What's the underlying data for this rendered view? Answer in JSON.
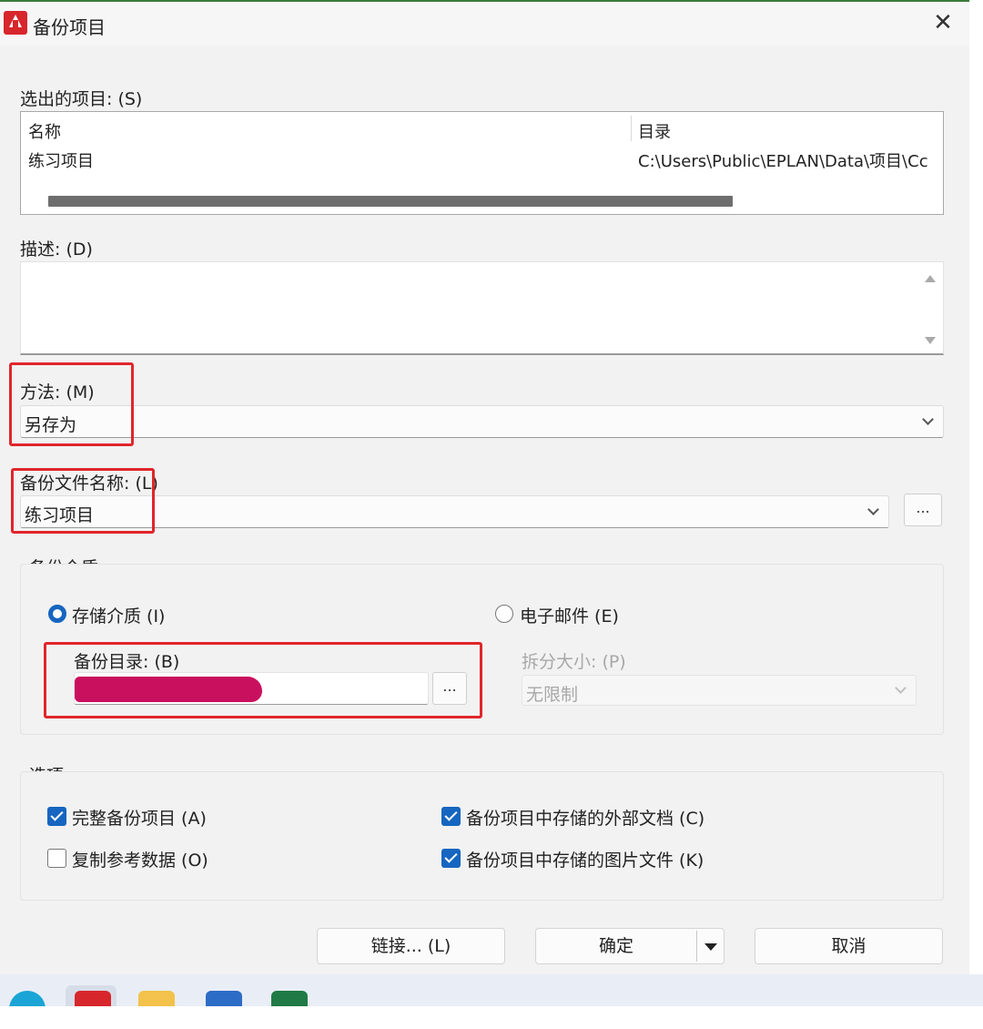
{
  "title": "备份项目",
  "selected_projects": {
    "label": "选出的项目: (S)",
    "columns": [
      "名称",
      "目录"
    ],
    "rows": [
      [
        "练习项目",
        "C:\\Users\\Public\\EPLAN\\Data\\项目\\Cc"
      ]
    ]
  },
  "description": {
    "label": "描述: (D)",
    "value": ""
  },
  "method": {
    "label": "方法: (M)",
    "value": "另存为"
  },
  "backup_filename": {
    "label": "备份文件名称: (L)",
    "value": "练习项目",
    "browse_label": "..."
  },
  "backup_media": {
    "label": "备份介质",
    "storage_label": "存储介质 (I)",
    "storage_selected": true,
    "email_label": "电子邮件 (E)",
    "email_selected": false,
    "backup_dir_label": "备份目录: (B)",
    "backup_dir_browse": "...",
    "split_size_label": "拆分大小: (P)",
    "split_size_value": "无限制"
  },
  "options": {
    "label": "选项",
    "full_backup_label": "完整备份项目 (A)",
    "full_backup_checked": true,
    "copy_ref_label": "复制参考数据 (O)",
    "copy_ref_checked": false,
    "ext_docs_label": "备份项目中存储的外部文档 (C)",
    "ext_docs_checked": true,
    "images_label": "备份项目中存储的图片文件 (K)",
    "images_checked": true
  },
  "buttons": {
    "link": "链接... (L)",
    "ok": "确定",
    "cancel": "取消"
  },
  "colors": {
    "accent": "#1665c0",
    "highlight": "#e0262b",
    "redaction": "#c9105e",
    "app_red": "#d7262c"
  }
}
